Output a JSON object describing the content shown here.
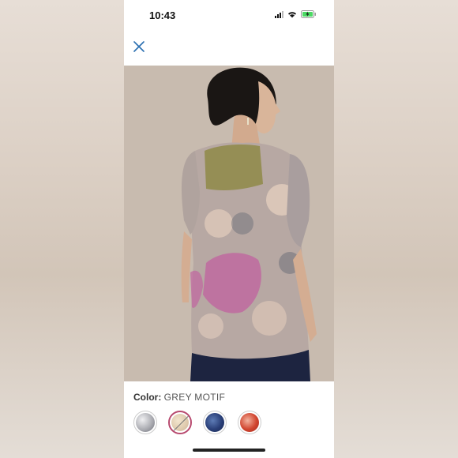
{
  "status_bar": {
    "time": "10:43"
  },
  "product": {
    "color_label": "Color:",
    "color_value": "GREY MOTIF",
    "swatches": [
      {
        "name": "grey-motif",
        "color": "#cfcfd2",
        "selected": false,
        "unavailable": false
      },
      {
        "name": "neutral-motif",
        "color": "#e7d9c2",
        "selected": true,
        "unavailable": true
      },
      {
        "name": "navy-motif",
        "color": "#1f3466",
        "selected": false,
        "unavailable": false
      },
      {
        "name": "red-motif",
        "color": "#c0392b",
        "selected": false,
        "unavailable": false
      }
    ]
  },
  "colors": {
    "selected_ring": "#b84a6f",
    "close_icon": "#2a6fb0"
  }
}
